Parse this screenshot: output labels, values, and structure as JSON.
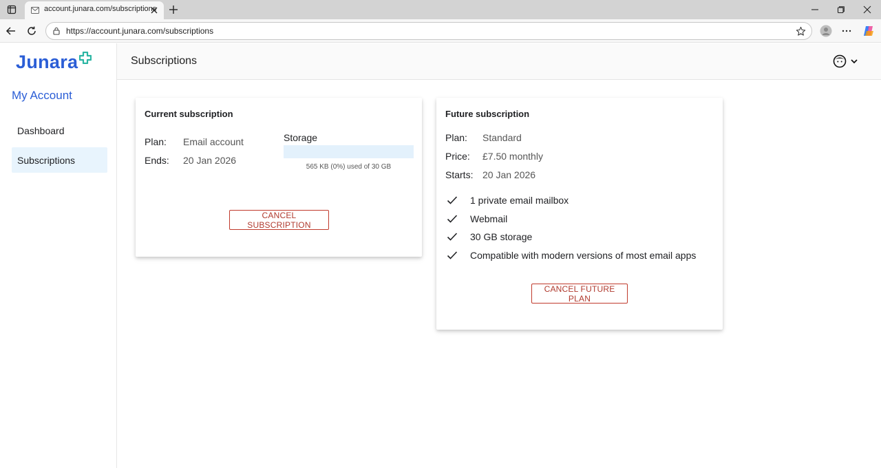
{
  "browser": {
    "tab_title": "account.junara.com/subscriptions",
    "url": "https://account.junara.com/subscriptions"
  },
  "sidebar": {
    "logo_text": "Junara",
    "section_title": "My Account",
    "items": [
      {
        "label": "Dashboard",
        "active": false
      },
      {
        "label": "Subscriptions",
        "active": true
      }
    ]
  },
  "header": {
    "title": "Subscriptions"
  },
  "current_subscription": {
    "title": "Current subscription",
    "plan_label": "Plan:",
    "plan_value": "Email account",
    "ends_label": "Ends:",
    "ends_value": "20 Jan 2026",
    "storage_label": "Storage",
    "storage_used_percent": 0,
    "storage_caption": "565 KB (0%) used of 30 GB",
    "cancel_button": "CANCEL SUBSCRIPTION"
  },
  "future_subscription": {
    "title": "Future subscription",
    "plan_label": "Plan:",
    "plan_value": "Standard",
    "price_label": "Price:",
    "price_value": "£7.50 monthly",
    "starts_label": "Starts:",
    "starts_value": "20 Jan 2026",
    "features": [
      "1 private email mailbox",
      "Webmail",
      "30 GB storage",
      "Compatible with modern versions of most email apps"
    ],
    "cancel_button": "CANCEL FUTURE PLAN"
  },
  "colors": {
    "brand_blue": "#2b5ed6",
    "brand_teal": "#2bb5a3",
    "danger": "#c0392b",
    "active_nav_bg": "#e8f4fd"
  },
  "icons": {
    "tab_actions": "tab-actions-icon",
    "favicon": "mail-icon",
    "user_menu": "user-avatar-icon",
    "feature": "check-icon"
  }
}
